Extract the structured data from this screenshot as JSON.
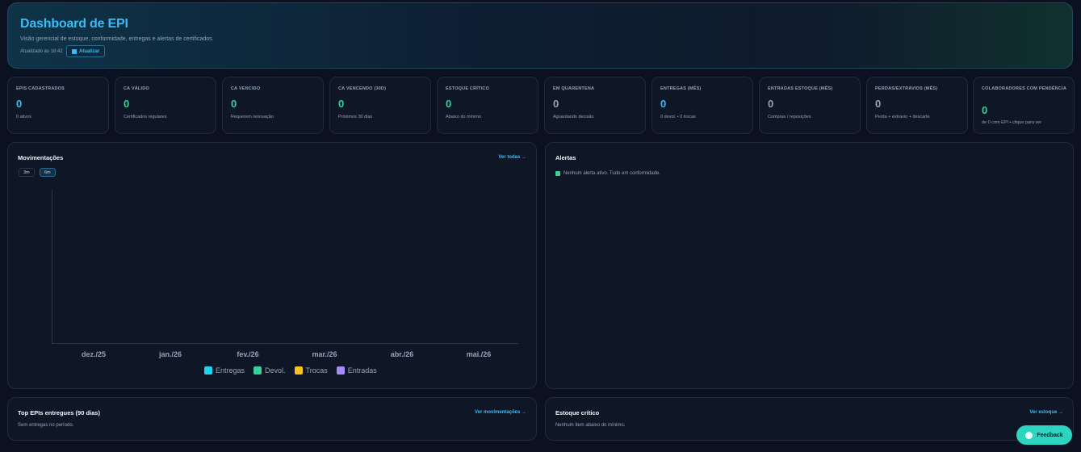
{
  "header": {
    "title": "Dashboard de EPI",
    "subtitle": "Visão gerencial de estoque, conformidade, entregas e alertas de certificados.",
    "updated": "Atualizado às 18:42",
    "refresh_label": "Atualizar",
    "refresh_icon": "refresh-icon"
  },
  "kpis": [
    {
      "label": "EPIs cadastrados",
      "value": "0",
      "desc": "0 ativos",
      "color": "#38bdf8"
    },
    {
      "label": "CA válido",
      "value": "0",
      "desc": "Certificados regulares",
      "color": "#34d399"
    },
    {
      "label": "CA vencido",
      "value": "0",
      "desc": "Requerem renovação",
      "color": "#34d399"
    },
    {
      "label": "CA vencendo (30d)",
      "value": "0",
      "desc": "Próximos 30 dias",
      "color": "#34d399"
    },
    {
      "label": "Estoque crítico",
      "value": "0",
      "desc": "Abaixo do mínimo",
      "color": "#34d399"
    },
    {
      "label": "Em quarentena",
      "value": "0",
      "desc": "Aguardando decisão",
      "color": "#94a3b8"
    },
    {
      "label": "Entregas (mês)",
      "value": "0",
      "desc": "0 devol. • 0 trocas",
      "color": "#38bdf8"
    },
    {
      "label": "Entradas estoque (mês)",
      "value": "0",
      "desc": "Compras / reposições",
      "color": "#94a3b8"
    },
    {
      "label": "Perdas/extravios (mês)",
      "value": "0",
      "desc": "Perda + extravio + descarte",
      "color": "#94a3b8"
    },
    {
      "label": "Colaboradores com pendência",
      "value": "0",
      "desc": "de 0 com EPI • clique para ver",
      "color": "#34d399"
    }
  ],
  "movimentacoes": {
    "title": "Movimentações",
    "link": "Ver todas →",
    "ranges": [
      "3m",
      "6m"
    ],
    "active_range": "6m"
  },
  "chart_data": {
    "type": "bar",
    "categories": [
      "dez./25",
      "jan./26",
      "fev./26",
      "mar./26",
      "abr./26",
      "mai./26"
    ],
    "series": [
      {
        "name": "Entregas",
        "color": "#22d3ee",
        "values": [
          0,
          0,
          0,
          0,
          0,
          0
        ]
      },
      {
        "name": "Devol.",
        "color": "#34d399",
        "values": [
          0,
          0,
          0,
          0,
          0,
          0
        ]
      },
      {
        "name": "Trocas",
        "color": "#fbbf24",
        "values": [
          0,
          0,
          0,
          0,
          0,
          0
        ]
      },
      {
        "name": "Entradas",
        "color": "#a78bfa",
        "values": [
          0,
          0,
          0,
          0,
          0,
          0
        ]
      }
    ],
    "title": "",
    "xlabel": "",
    "ylabel": "",
    "legend": "bottom"
  },
  "alertas": {
    "title": "Alertas",
    "message": "Nenhum alerta ativo. Tudo em conformidade."
  },
  "top_epis": {
    "title": "Top EPIs entregues (90 dias)",
    "link": "Ver movimentações →",
    "empty": "Sem entregas no período."
  },
  "estoque_critico": {
    "title": "Estoque crítico",
    "link": "Ver estoque →",
    "empty": "Nenhum item abaixo do mínimo."
  },
  "feedback": {
    "label": "Feedback"
  }
}
